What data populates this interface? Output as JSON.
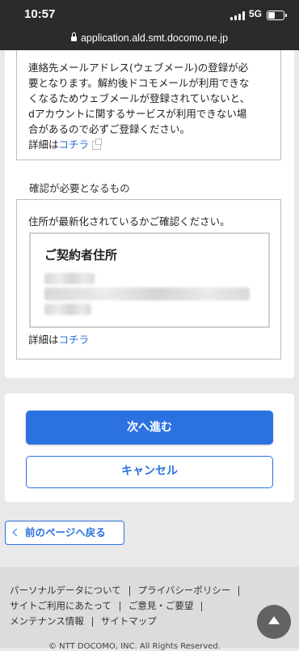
{
  "status_bar": {
    "time": "10:57",
    "network": "5G"
  },
  "url_bar": {
    "url": "application.ald.smt.docomo.ne.jp"
  },
  "notice": {
    "text": "連絡先メールアドレス(ウェブメール)の登録が必\n要となります。解約後ドコモメールが利用できな\nくなるためウェブメールが登録されていないと、\ndアカウントに関するサービスが利用できない場\n合があるので必ずご登録ください。",
    "detail_prefix": "詳細は",
    "detail_link": "コチラ"
  },
  "confirm_section": {
    "label": "確認が必要となるもの",
    "instruction": "住所が最新化されているかご確認ください。",
    "address_title": "ご契約者住所",
    "detail_prefix": "詳細は",
    "detail_link": "コチラ"
  },
  "actions": {
    "next_label": "次へ進む",
    "cancel_label": "キャンセル"
  },
  "back": {
    "label": "前のページへ戻る"
  },
  "footer": {
    "links": [
      "パーソナルデータについて",
      "プライバシーポリシー",
      "サイトご利用にあたって",
      "ご意見・ご要望",
      "メンテナンス情報",
      "サイトマップ"
    ],
    "copyright": "© NTT DOCOMO, INC. All Rights Reserved."
  },
  "colors": {
    "accent": "#2b72e0",
    "status_bar_bg": "#2b2b2b",
    "page_bg": "#e9e9e9"
  }
}
